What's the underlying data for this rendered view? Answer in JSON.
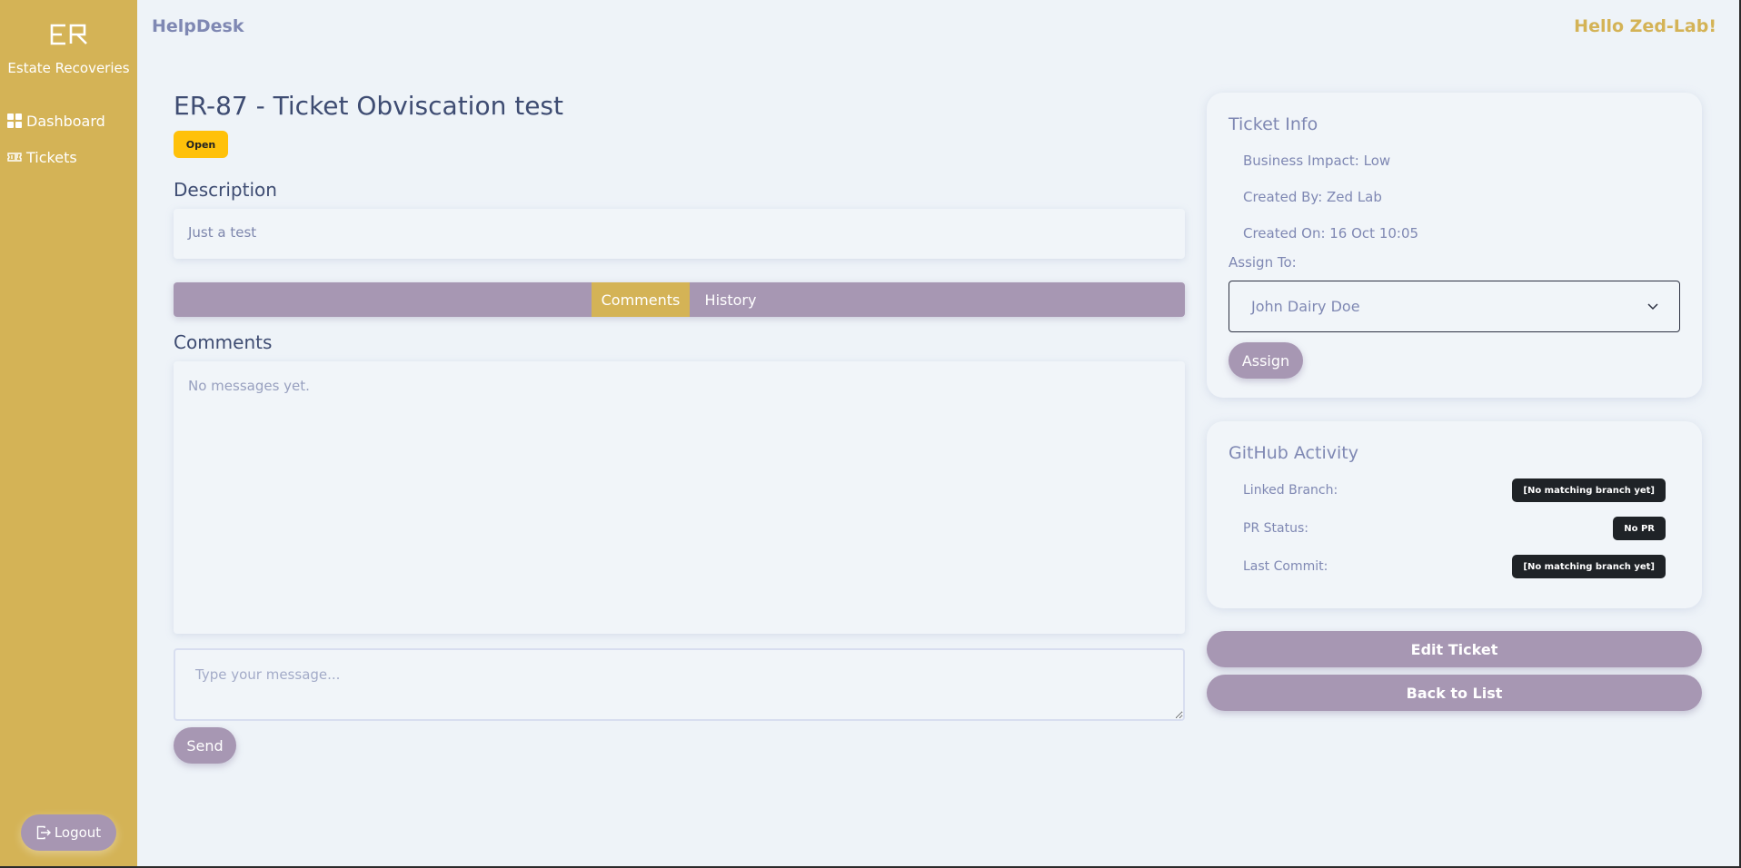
{
  "app": {
    "logo_text": "ER",
    "brand": "Estate Recoveries",
    "title": "HelpDesk",
    "greeting": "Hello Zed-Lab!"
  },
  "sidebar": {
    "items": [
      {
        "label": "Dashboard",
        "icon": "grid-icon"
      },
      {
        "label": "Tickets",
        "icon": "ticket-icon"
      }
    ],
    "logout_label": "Logout"
  },
  "ticket": {
    "title": "ER-87 - Ticket Obviscation test",
    "status": "Open",
    "description_heading": "Description",
    "description": "Just a test"
  },
  "tabs": [
    {
      "label": "Comments",
      "active": true
    },
    {
      "label": "History",
      "active": false
    }
  ],
  "comments": {
    "heading": "Comments",
    "empty_text": "No messages yet.",
    "input_placeholder": "Type your message...",
    "send_label": "Send"
  },
  "ticket_info": {
    "heading": "Ticket Info",
    "business_impact": "Business Impact: Low",
    "created_by": "Created By: Zed Lab",
    "created_on": "Created On: 16 Oct 10:05",
    "assign_label": "Assign To:",
    "assignee": "John Dairy Doe",
    "assign_button": "Assign"
  },
  "github": {
    "heading": "GitHub Activity",
    "rows": [
      {
        "label": "Linked Branch:",
        "value": "[No matching branch yet]"
      },
      {
        "label": "PR Status:",
        "value": "No PR"
      },
      {
        "label": "Last Commit:",
        "value": "[No matching branch yet]"
      }
    ]
  },
  "actions": {
    "edit_label": "Edit Ticket",
    "back_label": "Back to List"
  },
  "colors": {
    "sidebar": "#d4b356",
    "accent": "#a797b3",
    "status_open": "#ffc10a",
    "background": "#eef3f8"
  }
}
